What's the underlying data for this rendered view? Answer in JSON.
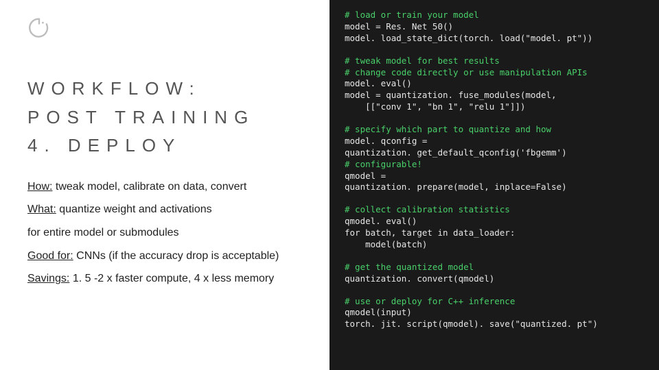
{
  "title": {
    "line1": "WORKFLOW:",
    "line2": "POST TRAINING",
    "line3": "4. DEPLOY"
  },
  "bullets": {
    "how_label": "How:",
    "how_text": " tweak model, calibrate on data, convert",
    "what_label": "What:",
    "what_text": " quantize weight and activations",
    "what_sub": "for entire model or submodules",
    "good_label": "Good for:",
    "good_text": " CNNs (if the accuracy drop is acceptable)",
    "savings_label": "Savings:",
    "savings_text": " 1. 5 -2 x faster compute, 4 x less memory"
  },
  "code": {
    "b1_c1": "# load or train your model",
    "b1_l1": "model = Res. Net 50()",
    "b1_l2": "model. load_state_dict(torch. load(\"model. pt\"))",
    "b2_c1": "# tweak model for best results",
    "b2_c2": "# change code directly or use manipulation APIs",
    "b2_l1": "model. eval()",
    "b2_l2": "model = quantization. fuse_modules(model,",
    "b2_l3": "    [[\"conv 1\", \"bn 1\", \"relu 1\"]])",
    "b3_c1": "# specify which part to quantize and how",
    "b3_l1": "model. qconfig =",
    "b3_l2": "quantization. get_default_qconfig('fbgemm')",
    "b3_c2": "# configurable!",
    "b3_l3": "qmodel =",
    "b3_l4": "quantization. prepare(model, inplace=False)",
    "b4_c1": "# collect calibration statistics",
    "b4_l1": "qmodel. eval()",
    "b4_l2": "for batch, target in data_loader:",
    "b4_l3": "    model(batch)",
    "b5_c1": "# get the quantized model",
    "b5_l1": "quantization. convert(qmodel)",
    "b6_c1": "# use or deploy for C++ inference",
    "b6_l1": "qmodel(input)",
    "b6_l2": "torch. jit. script(qmodel). save(\"quantized. pt\")"
  }
}
